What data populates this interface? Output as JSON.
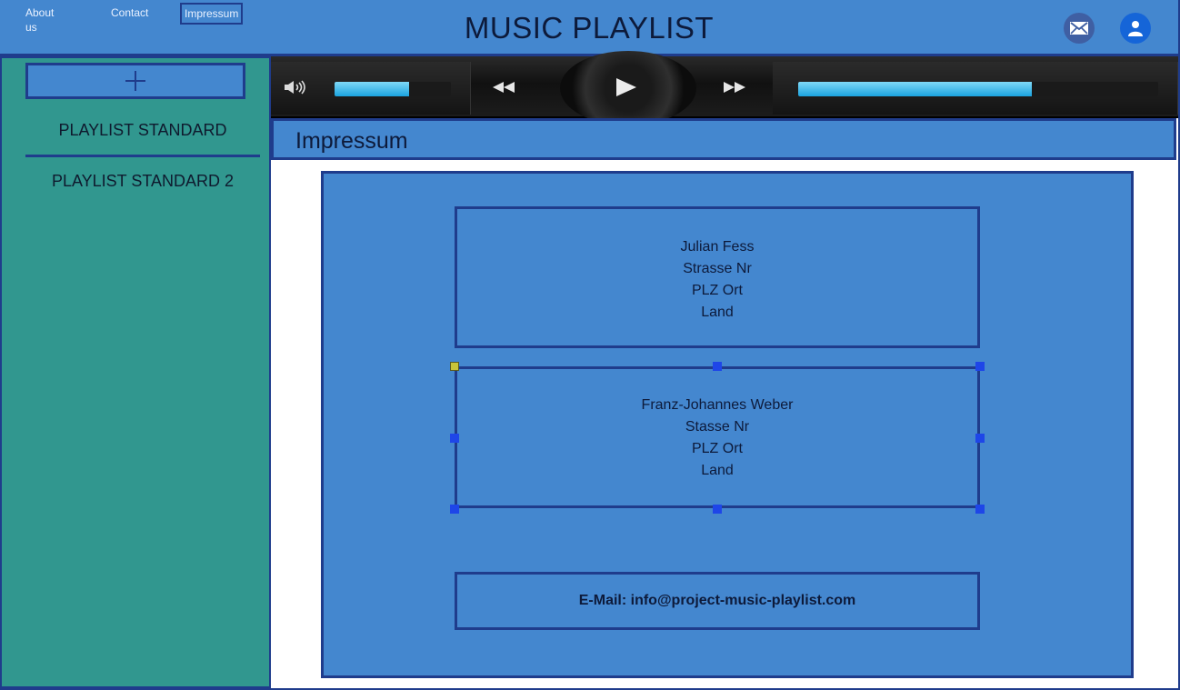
{
  "header": {
    "title": "MUSIC PLAYLIST",
    "nav": [
      "About us",
      "Contact",
      "Impressum"
    ]
  },
  "sidebar": {
    "add_label": "+",
    "playlists": [
      "PLAYLIST STANDARD",
      "PLAYLIST STANDARD 2"
    ]
  },
  "player": {
    "volume_fraction": 0.64,
    "progress_fraction": 0.65
  },
  "page": {
    "title": "Impressum"
  },
  "impressum": {
    "person1": [
      "Julian Fess",
      "Strasse Nr",
      "PLZ Ort",
      "Land"
    ],
    "person2": [
      "Franz-Johannes Weber",
      "Stasse Nr",
      "PLZ Ort",
      "Land"
    ],
    "email": "E-Mail: info@project-music-playlist.com"
  },
  "colors": {
    "primary": "#4487cf",
    "border": "#1f3c8c",
    "sidebar": "#31978f"
  }
}
